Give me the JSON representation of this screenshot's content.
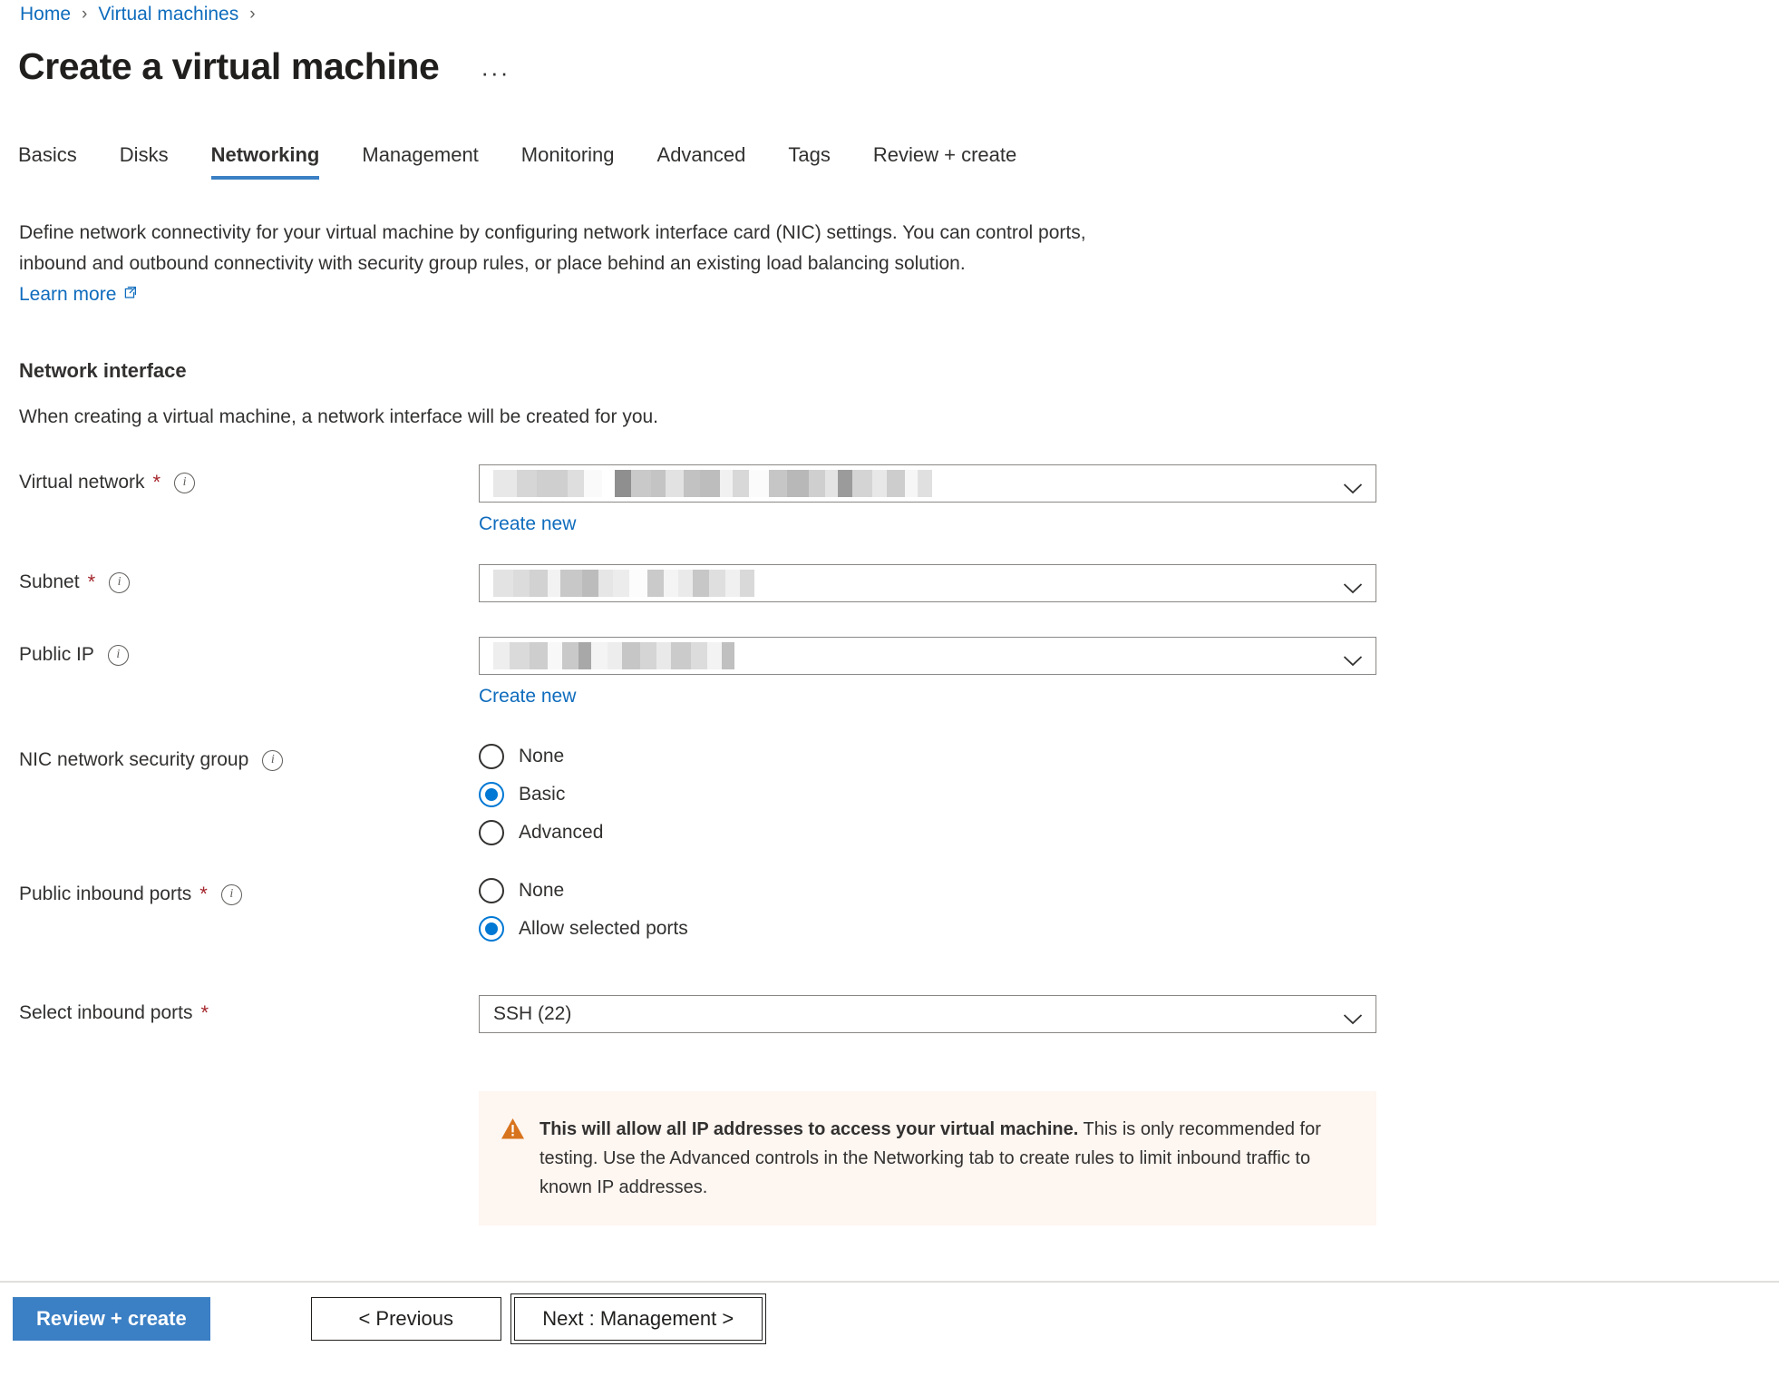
{
  "breadcrumb": {
    "items": [
      {
        "label": "Home",
        "link": true
      },
      {
        "label": "Virtual machines",
        "link": true
      }
    ],
    "separator": "›"
  },
  "header": {
    "title": "Create a virtual machine",
    "more_label": "···"
  },
  "tabs": [
    {
      "label": "Basics",
      "active": false
    },
    {
      "label": "Disks",
      "active": false
    },
    {
      "label": "Networking",
      "active": true
    },
    {
      "label": "Management",
      "active": false
    },
    {
      "label": "Monitoring",
      "active": false
    },
    {
      "label": "Advanced",
      "active": false
    },
    {
      "label": "Tags",
      "active": false
    },
    {
      "label": "Review + create",
      "active": false
    }
  ],
  "intro": {
    "line1": "Define network connectivity for your virtual machine by configuring network interface card (NIC) settings. You can control ports,",
    "line2": "inbound and outbound connectivity with security group rules, or place behind an existing load balancing solution.",
    "learn_more": "Learn more"
  },
  "section": {
    "title": "Network interface",
    "description": "When creating a virtual machine, a network interface will be created for you."
  },
  "fields": {
    "virtual_network": {
      "label": "Virtual network",
      "required": "*",
      "value": "",
      "redacted": true,
      "create_new": "Create new"
    },
    "subnet": {
      "label": "Subnet",
      "required": "*",
      "value": "",
      "redacted": true
    },
    "public_ip": {
      "label": "Public IP",
      "required": "",
      "value": "",
      "redacted": true,
      "create_new": "Create new"
    },
    "nic_nsg": {
      "label": "NIC network security group",
      "required": "",
      "options": [
        {
          "label": "None",
          "selected": false
        },
        {
          "label": "Basic",
          "selected": true
        },
        {
          "label": "Advanced",
          "selected": false
        }
      ],
      "selected_value": "Basic"
    },
    "public_inbound_ports": {
      "label": "Public inbound ports",
      "required": "*",
      "options": [
        {
          "label": "None",
          "selected": false
        },
        {
          "label": "Allow selected ports",
          "selected": true
        }
      ],
      "selected_value": "Allow selected ports"
    },
    "select_inbound_ports": {
      "label": "Select inbound ports",
      "required": "*",
      "value": "SSH (22)"
    }
  },
  "warning": {
    "strong": "This will allow all IP addresses to access your virtual machine.",
    "rest": " This is only recommended for testing.  Use the Advanced controls in the Networking tab to create rules to limit inbound traffic to known IP addresses."
  },
  "footer": {
    "review_create": "Review + create",
    "previous": "< Previous",
    "next": "Next : Management >"
  },
  "colors": {
    "accent": "#0f6cbd",
    "tab_underline": "#3b7fc4",
    "primary_button": "#3b7fc4",
    "required_asterisk": "#a4262c",
    "warning_bg": "#fef6f1",
    "warning_icon": "#d8731d",
    "radio_selected": "#0078d4"
  },
  "icons": {
    "external_link": "external-link-icon",
    "chevron_down": "chevron-down-icon",
    "info": "info-icon",
    "warning": "warning-triangle-icon"
  }
}
